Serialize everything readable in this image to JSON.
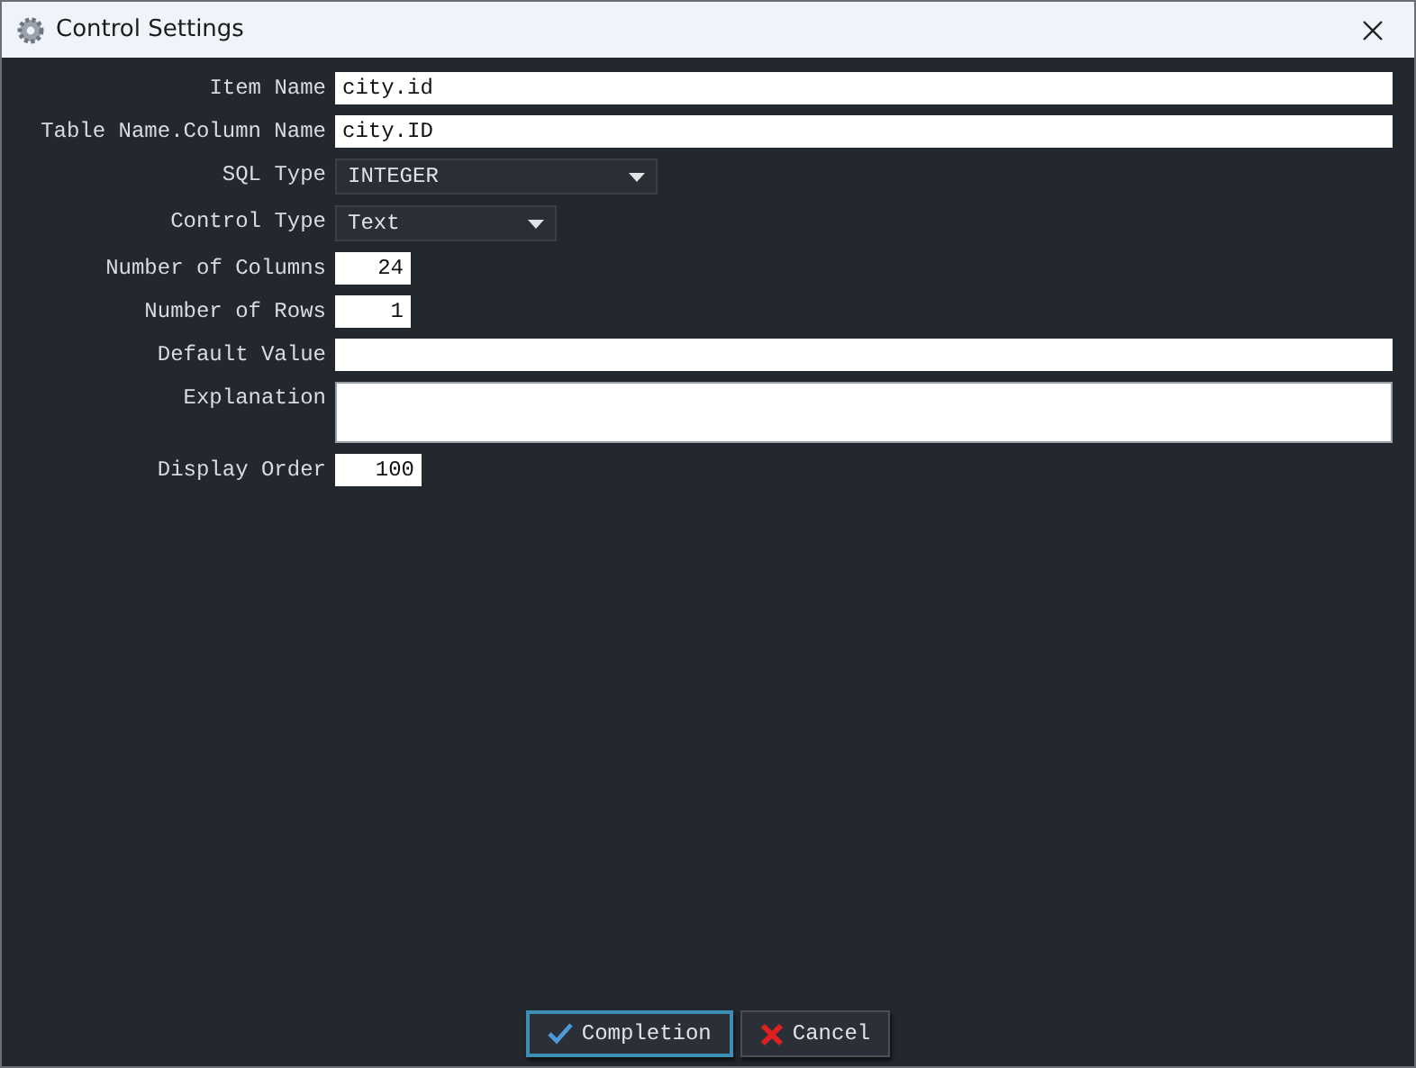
{
  "window": {
    "title": "Control Settings"
  },
  "fields": [
    {
      "label": "Item Name",
      "kind": "text",
      "value": "city.id"
    },
    {
      "label": "Table Name.Column Name",
      "kind": "text",
      "value": "city.ID"
    },
    {
      "label": "SQL Type",
      "kind": "select",
      "value": "INTEGER"
    },
    {
      "label": "Control Type",
      "kind": "select",
      "value": "Text"
    },
    {
      "label": "Number of Columns",
      "kind": "number",
      "value": "24"
    },
    {
      "label": "Number of Rows",
      "kind": "number",
      "value": "1"
    },
    {
      "label": "Default Value",
      "kind": "text"
    },
    {
      "label": "Explanation",
      "kind": "textarea"
    },
    {
      "label": "Display Order",
      "kind": "number",
      "value": "100"
    }
  ],
  "buttons": [
    {
      "label": "Completion",
      "kind": "ok",
      "focused": true
    },
    {
      "label": "Cancel",
      "kind": "cancel",
      "focused": false
    }
  ]
}
